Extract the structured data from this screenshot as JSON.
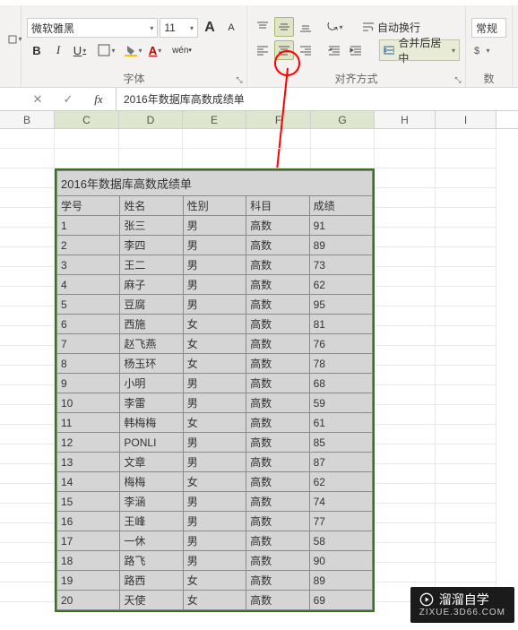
{
  "ribbon": {
    "font": {
      "name_value": "微软雅黑",
      "size_value": "11",
      "inc_label": "A",
      "dec_label": "A",
      "bold": "B",
      "italic": "I",
      "underline": "U",
      "group_label": "字体"
    },
    "align": {
      "wrap": "自动换行",
      "merge": "合并后居中",
      "group_label": "对齐方式"
    },
    "number": {
      "format": "常规",
      "group_label": "数"
    }
  },
  "formula_bar": {
    "cancel": "✕",
    "confirm": "✓",
    "fx": "fx",
    "value": "2016年数据库高数成绩单"
  },
  "columns": [
    "B",
    "C",
    "D",
    "E",
    "F",
    "G",
    "H",
    "I"
  ],
  "table": {
    "title": "2016年数据库高数成绩单",
    "headers": [
      "学号",
      "姓名",
      "性别",
      "科目",
      "成绩"
    ],
    "rows": [
      [
        "1",
        "张三",
        "男",
        "高数",
        "91"
      ],
      [
        "2",
        "李四",
        "男",
        "高数",
        "89"
      ],
      [
        "3",
        "王二",
        "男",
        "高数",
        "73"
      ],
      [
        "4",
        "麻子",
        "男",
        "高数",
        "62"
      ],
      [
        "5",
        "豆腐",
        "男",
        "高数",
        "95"
      ],
      [
        "6",
        "西施",
        "女",
        "高数",
        "81"
      ],
      [
        "7",
        "赵飞燕",
        "女",
        "高数",
        "76"
      ],
      [
        "8",
        "杨玉环",
        "女",
        "高数",
        "78"
      ],
      [
        "9",
        "小明",
        "男",
        "高数",
        "68"
      ],
      [
        "10",
        "李雷",
        "男",
        "高数",
        "59"
      ],
      [
        "11",
        "韩梅梅",
        "女",
        "高数",
        "61"
      ],
      [
        "12",
        "PONLI",
        "男",
        "高数",
        "85"
      ],
      [
        "13",
        "文章",
        "男",
        "高数",
        "87"
      ],
      [
        "14",
        "梅梅",
        "女",
        "高数",
        "62"
      ],
      [
        "15",
        "李涵",
        "男",
        "高数",
        "74"
      ],
      [
        "16",
        "王峰",
        "男",
        "高数",
        "77"
      ],
      [
        "17",
        "一休",
        "男",
        "高数",
        "58"
      ],
      [
        "18",
        "路飞",
        "男",
        "高数",
        "90"
      ],
      [
        "19",
        "路西",
        "女",
        "高数",
        "89"
      ],
      [
        "20",
        "天使",
        "女",
        "高数",
        "69"
      ]
    ]
  },
  "selected_cols": [
    "C",
    "D",
    "E",
    "F",
    "G"
  ],
  "watermark": {
    "title": "溜溜自学",
    "sub": "ZIXUE.3D66.COM"
  }
}
